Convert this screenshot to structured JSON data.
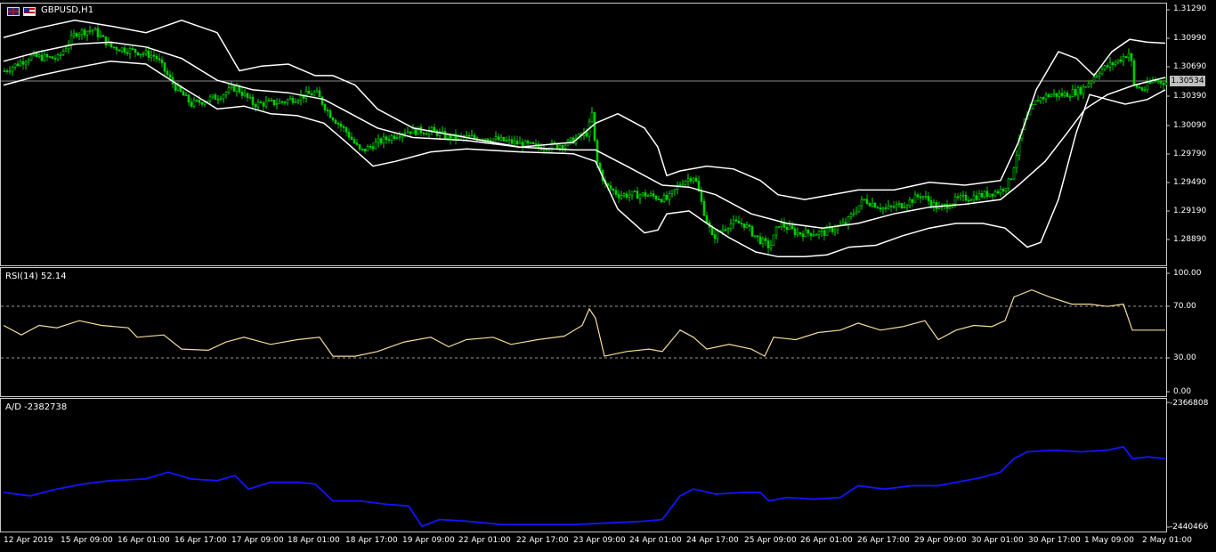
{
  "symbol_label": "GBPUSD,H1",
  "current_price": "1.30534",
  "colors": {
    "background": "#000000",
    "frame": "#c8c8c8",
    "candle_bull": "#00e000",
    "band": "#ffffff",
    "rsi_line": "#f5dc9a",
    "rsi_level": "#9a9a9a",
    "ad_line": "#1414ff",
    "price_tag_bg": "#c0c0c0"
  },
  "price_axis": [
    "1.31290",
    "1.30990",
    "1.30690",
    "1.30390",
    "1.30090",
    "1.29790",
    "1.29490",
    "1.29190",
    "1.28890"
  ],
  "rsi": {
    "label": "RSI(14) 52.14",
    "axis": [
      "100.00",
      "70.00",
      "30.00",
      "0.00"
    ],
    "levels": [
      70,
      30
    ]
  },
  "ad": {
    "label": "A/D -2382738",
    "axis": [
      "-2366808",
      "-2440466"
    ]
  },
  "time_axis": [
    "12 Apr 2019",
    "15 Apr 09:00",
    "16 Apr 01:00",
    "16 Apr 17:00",
    "17 Apr 09:00",
    "18 Apr 01:00",
    "18 Apr 17:00",
    "19 Apr 09:00",
    "22 Apr 01:00",
    "22 Apr 17:00",
    "23 Apr 09:00",
    "24 Apr 01:00",
    "24 Apr 17:00",
    "25 Apr 09:00",
    "26 Apr 01:00",
    "26 Apr 17:00",
    "29 Apr 09:00",
    "30 Apr 01:00",
    "30 Apr 17:00",
    "1 May 09:00",
    "2 May 01:00"
  ],
  "chart_data": {
    "type": "line",
    "price_path": [
      [
        0,
        1.3065
      ],
      [
        30,
        1.308
      ],
      [
        60,
        1.3078
      ],
      [
        80,
        1.3105
      ],
      [
        100,
        1.3108
      ],
      [
        120,
        1.309
      ],
      [
        150,
        1.3085
      ],
      [
        170,
        1.308
      ],
      [
        190,
        1.305
      ],
      [
        210,
        1.303
      ],
      [
        240,
        1.3038
      ],
      [
        260,
        1.3048
      ],
      [
        280,
        1.303
      ],
      [
        310,
        1.3032
      ],
      [
        340,
        1.304
      ],
      [
        350,
        1.3042
      ],
      [
        365,
        1.302
      ],
      [
        385,
        1.3
      ],
      [
        400,
        1.298
      ],
      [
        420,
        1.299
      ],
      [
        450,
        1.3002
      ],
      [
        480,
        1.3002
      ],
      [
        500,
        1.2995
      ],
      [
        540,
        1.2995
      ],
      [
        570,
        1.299
      ],
      [
        600,
        1.2985
      ],
      [
        630,
        1.2988
      ],
      [
        655,
        1.3
      ],
      [
        660,
        1.302
      ],
      [
        665,
        1.297
      ],
      [
        675,
        1.2945
      ],
      [
        690,
        1.2935
      ],
      [
        720,
        1.2935
      ],
      [
        745,
        1.293
      ],
      [
        760,
        1.2948
      ],
      [
        775,
        1.2955
      ],
      [
        785,
        1.292
      ],
      [
        795,
        1.289
      ],
      [
        815,
        1.2905
      ],
      [
        830,
        1.2905
      ],
      [
        845,
        1.289
      ],
      [
        860,
        1.288
      ],
      [
        870,
        1.2905
      ],
      [
        890,
        1.2895
      ],
      [
        920,
        1.2895
      ],
      [
        945,
        1.2905
      ],
      [
        965,
        1.293
      ],
      [
        990,
        1.292
      ],
      [
        1010,
        1.2925
      ],
      [
        1030,
        1.2935
      ],
      [
        1050,
        1.292
      ],
      [
        1070,
        1.293
      ],
      [
        1100,
        1.2935
      ],
      [
        1120,
        1.294
      ],
      [
        1130,
        1.295
      ],
      [
        1145,
        1.301
      ],
      [
        1160,
        1.3035
      ],
      [
        1175,
        1.304
      ],
      [
        1190,
        1.304
      ],
      [
        1210,
        1.3045
      ],
      [
        1230,
        1.3065
      ],
      [
        1250,
        1.3075
      ],
      [
        1265,
        1.3085
      ],
      [
        1268,
        1.305
      ],
      [
        1280,
        1.3045
      ],
      [
        1290,
        1.3055
      ],
      [
        1305,
        1.3053
      ]
    ],
    "upper_band": [
      [
        0,
        1.31
      ],
      [
        40,
        1.311
      ],
      [
        80,
        1.3118
      ],
      [
        120,
        1.3112
      ],
      [
        160,
        1.3105
      ],
      [
        200,
        1.3118
      ],
      [
        240,
        1.3105
      ],
      [
        265,
        1.3065
      ],
      [
        290,
        1.307
      ],
      [
        320,
        1.3072
      ],
      [
        350,
        1.306
      ],
      [
        370,
        1.306
      ],
      [
        395,
        1.305
      ],
      [
        420,
        1.3025
      ],
      [
        460,
        1.3005
      ],
      [
        520,
        1.2995
      ],
      [
        580,
        1.2985
      ],
      [
        640,
        1.299
      ],
      [
        665,
        1.301
      ],
      [
        690,
        1.302
      ],
      [
        720,
        1.3005
      ],
      [
        735,
        1.2985
      ],
      [
        745,
        1.2955
      ],
      [
        760,
        1.296
      ],
      [
        790,
        1.2965
      ],
      [
        820,
        1.2962
      ],
      [
        850,
        1.295
      ],
      [
        870,
        1.2935
      ],
      [
        900,
        1.293
      ],
      [
        930,
        1.2935
      ],
      [
        960,
        1.294
      ],
      [
        1000,
        1.294
      ],
      [
        1040,
        1.2948
      ],
      [
        1080,
        1.2945
      ],
      [
        1120,
        1.295
      ],
      [
        1140,
        1.299
      ],
      [
        1160,
        1.3045
      ],
      [
        1185,
        1.3085
      ],
      [
        1205,
        1.3078
      ],
      [
        1225,
        1.306
      ],
      [
        1245,
        1.3085
      ],
      [
        1265,
        1.3098
      ],
      [
        1285,
        1.3095
      ],
      [
        1305,
        1.3094
      ]
    ],
    "mid_band": [
      [
        0,
        1.3075
      ],
      [
        40,
        1.3085
      ],
      [
        80,
        1.3093
      ],
      [
        120,
        1.3095
      ],
      [
        160,
        1.309
      ],
      [
        200,
        1.3078
      ],
      [
        240,
        1.3055
      ],
      [
        280,
        1.3045
      ],
      [
        320,
        1.3042
      ],
      [
        360,
        1.3035
      ],
      [
        390,
        1.302
      ],
      [
        420,
        1.3005
      ],
      [
        460,
        1.2995
      ],
      [
        520,
        1.2992
      ],
      [
        580,
        1.2985
      ],
      [
        640,
        1.2982
      ],
      [
        665,
        1.2982
      ],
      [
        700,
        1.2965
      ],
      [
        740,
        1.2945
      ],
      [
        770,
        1.2943
      ],
      [
        800,
        1.2935
      ],
      [
        840,
        1.2915
      ],
      [
        880,
        1.2905
      ],
      [
        920,
        1.29
      ],
      [
        960,
        1.2905
      ],
      [
        1000,
        1.2915
      ],
      [
        1040,
        1.2922
      ],
      [
        1080,
        1.2925
      ],
      [
        1120,
        1.293
      ],
      [
        1140,
        1.2945
      ],
      [
        1170,
        1.297
      ],
      [
        1195,
        1.3
      ],
      [
        1215,
        1.3025
      ],
      [
        1240,
        1.304
      ],
      [
        1270,
        1.305
      ],
      [
        1305,
        1.3058
      ]
    ],
    "lower_band": [
      [
        0,
        1.305
      ],
      [
        40,
        1.306
      ],
      [
        80,
        1.3068
      ],
      [
        120,
        1.3075
      ],
      [
        160,
        1.3072
      ],
      [
        200,
        1.3048
      ],
      [
        240,
        1.3025
      ],
      [
        270,
        1.3028
      ],
      [
        300,
        1.302
      ],
      [
        330,
        1.3018
      ],
      [
        360,
        1.301
      ],
      [
        385,
        1.299
      ],
      [
        415,
        1.2965
      ],
      [
        440,
        1.297
      ],
      [
        480,
        1.298
      ],
      [
        520,
        1.2983
      ],
      [
        580,
        1.298
      ],
      [
        640,
        1.2978
      ],
      [
        665,
        1.297
      ],
      [
        690,
        1.292
      ],
      [
        720,
        1.2895
      ],
      [
        735,
        1.2898
      ],
      [
        745,
        1.2915
      ],
      [
        770,
        1.2918
      ],
      [
        790,
        1.2905
      ],
      [
        815,
        1.289
      ],
      [
        845,
        1.2875
      ],
      [
        870,
        1.287
      ],
      [
        900,
        1.287
      ],
      [
        925,
        1.2872
      ],
      [
        950,
        1.288
      ],
      [
        980,
        1.2882
      ],
      [
        1010,
        1.2892
      ],
      [
        1040,
        1.29
      ],
      [
        1070,
        1.2905
      ],
      [
        1100,
        1.2905
      ],
      [
        1125,
        1.29
      ],
      [
        1150,
        1.288
      ],
      [
        1165,
        1.2885
      ],
      [
        1185,
        1.293
      ],
      [
        1205,
        1.3
      ],
      [
        1220,
        1.304
      ],
      [
        1240,
        1.3035
      ],
      [
        1260,
        1.303
      ],
      [
        1285,
        1.3035
      ],
      [
        1305,
        1.3045
      ]
    ],
    "rsi": [
      [
        0,
        56
      ],
      [
        20,
        48
      ],
      [
        40,
        56
      ],
      [
        60,
        54
      ],
      [
        85,
        60
      ],
      [
        110,
        56
      ],
      [
        140,
        54
      ],
      [
        150,
        46
      ],
      [
        180,
        48
      ],
      [
        200,
        36
      ],
      [
        230,
        35
      ],
      [
        250,
        42
      ],
      [
        270,
        46
      ],
      [
        300,
        40
      ],
      [
        330,
        44
      ],
      [
        355,
        46
      ],
      [
        370,
        30
      ],
      [
        395,
        30
      ],
      [
        420,
        34
      ],
      [
        450,
        42
      ],
      [
        480,
        46
      ],
      [
        500,
        38
      ],
      [
        520,
        44
      ],
      [
        550,
        46
      ],
      [
        570,
        40
      ],
      [
        600,
        44
      ],
      [
        630,
        47
      ],
      [
        650,
        56
      ],
      [
        658,
        70
      ],
      [
        665,
        62
      ],
      [
        675,
        30
      ],
      [
        700,
        34
      ],
      [
        725,
        36
      ],
      [
        740,
        34
      ],
      [
        760,
        52
      ],
      [
        775,
        46
      ],
      [
        790,
        36
      ],
      [
        815,
        40
      ],
      [
        840,
        36
      ],
      [
        855,
        30
      ],
      [
        865,
        46
      ],
      [
        890,
        44
      ],
      [
        915,
        50
      ],
      [
        940,
        52
      ],
      [
        960,
        58
      ],
      [
        985,
        52
      ],
      [
        1010,
        55
      ],
      [
        1035,
        60
      ],
      [
        1050,
        44
      ],
      [
        1070,
        52
      ],
      [
        1090,
        56
      ],
      [
        1110,
        55
      ],
      [
        1125,
        60
      ],
      [
        1135,
        80
      ],
      [
        1155,
        86
      ],
      [
        1175,
        80
      ],
      [
        1200,
        74
      ],
      [
        1220,
        74
      ],
      [
        1240,
        72
      ],
      [
        1258,
        74
      ],
      [
        1268,
        52
      ],
      [
        1285,
        52
      ],
      [
        1305,
        52
      ]
    ],
    "ad": [
      [
        0,
        -2420
      ],
      [
        30,
        -2422
      ],
      [
        60,
        -2418
      ],
      [
        90,
        -2415
      ],
      [
        120,
        -2413
      ],
      [
        160,
        -2412
      ],
      [
        185,
        -2408
      ],
      [
        210,
        -2412
      ],
      [
        240,
        -2413
      ],
      [
        260,
        -2410
      ],
      [
        275,
        -2418
      ],
      [
        300,
        -2414
      ],
      [
        330,
        -2414
      ],
      [
        350,
        -2415
      ],
      [
        370,
        -2425
      ],
      [
        400,
        -2425
      ],
      [
        430,
        -2427
      ],
      [
        455,
        -2428
      ],
      [
        470,
        -2440
      ],
      [
        490,
        -2436
      ],
      [
        520,
        -2437
      ],
      [
        560,
        -2439
      ],
      [
        600,
        -2439
      ],
      [
        640,
        -2439
      ],
      [
        680,
        -2438
      ],
      [
        720,
        -2437
      ],
      [
        740,
        -2436
      ],
      [
        760,
        -2422
      ],
      [
        775,
        -2418
      ],
      [
        800,
        -2421
      ],
      [
        830,
        -2420
      ],
      [
        850,
        -2420
      ],
      [
        860,
        -2425
      ],
      [
        880,
        -2423
      ],
      [
        910,
        -2424
      ],
      [
        940,
        -2423
      ],
      [
        960,
        -2416
      ],
      [
        990,
        -2418
      ],
      [
        1020,
        -2416
      ],
      [
        1050,
        -2416
      ],
      [
        1070,
        -2414
      ],
      [
        1100,
        -2411
      ],
      [
        1120,
        -2408
      ],
      [
        1135,
        -2400
      ],
      [
        1150,
        -2396
      ],
      [
        1180,
        -2395
      ],
      [
        1210,
        -2396
      ],
      [
        1240,
        -2395
      ],
      [
        1258,
        -2393
      ],
      [
        1268,
        -2400
      ],
      [
        1285,
        -2399
      ],
      [
        1305,
        -2400
      ]
    ]
  }
}
